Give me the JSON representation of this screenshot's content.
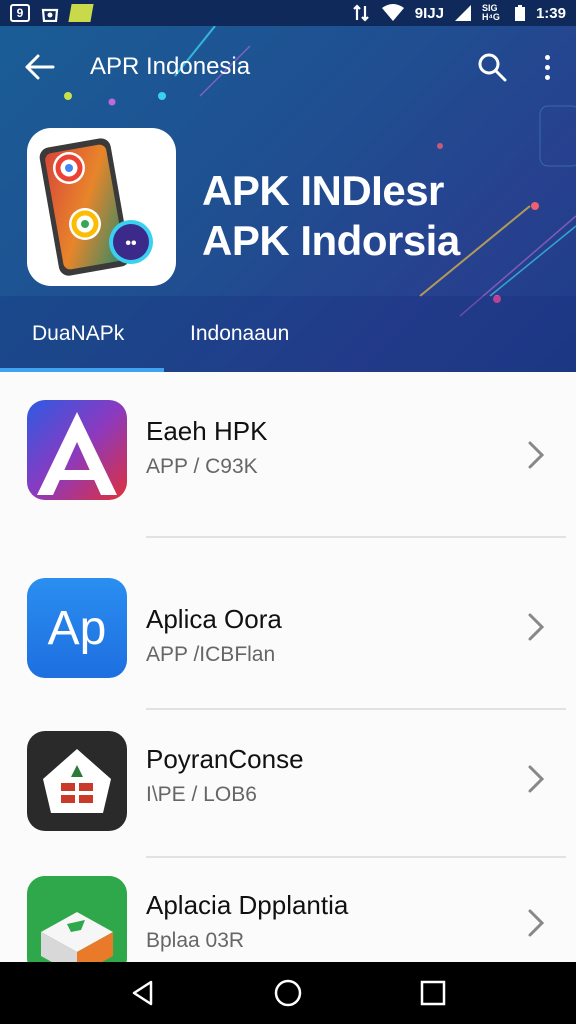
{
  "status_bar": {
    "left_box_text": "9",
    "small_text_1": "SIG",
    "small_text_2": "H⁴G",
    "signal_text": "9IJJ",
    "time": "1:39"
  },
  "toolbar": {
    "title": "APR Indonesia"
  },
  "hero": {
    "line1": "APK INDIesr",
    "line2": "APK Indorsia"
  },
  "tabs": [
    {
      "label": "DuaNAPk",
      "selected": true
    },
    {
      "label": "Indonaaun",
      "selected": false
    }
  ],
  "list": [
    {
      "title": "Eaeh HPK",
      "subtitle": "APP / C93K",
      "icon": "a-letter-app-icon"
    },
    {
      "title": "Aplica Oora",
      "subtitle": "APP /ICBFlan",
      "icon": "ap-app-icon"
    },
    {
      "title": "PoyranConse",
      "subtitle": "I\\PE / LOB6",
      "icon": "house-app-icon"
    },
    {
      "title": "Aplacia Dpplantia",
      "subtitle": "Bplaa 03R",
      "icon": "green-box-app-icon"
    }
  ],
  "colors": {
    "header_gradient_start": "#1a5d96",
    "header_gradient_end": "#1e3d88",
    "tab_indicator": "#3fa3f0",
    "list_background": "#fbfbfb"
  }
}
